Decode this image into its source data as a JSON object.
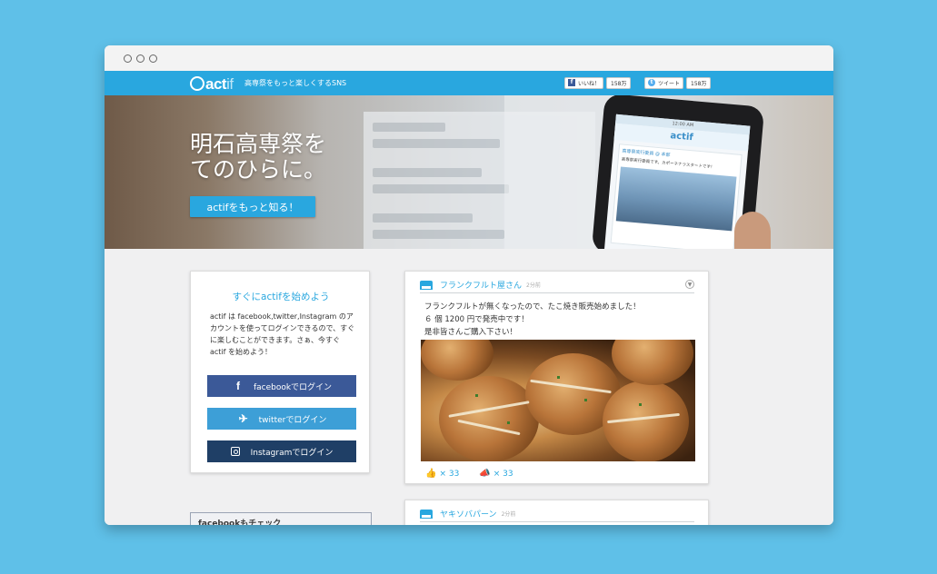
{
  "browser": {
    "controls": [
      "close",
      "minimize",
      "maximize"
    ]
  },
  "header": {
    "logo_main": "act",
    "logo_suffix": "if",
    "tagline": "高専祭をもっと楽しくするSNS",
    "facebook_like": {
      "label": "いいね！",
      "count": "158万"
    },
    "tweet": {
      "label": "ツイート",
      "count": "158万"
    }
  },
  "hero": {
    "headline_line1": "明石高専祭を",
    "headline_line2": "てのひらに。",
    "cta_label": "actifをもっと知る！",
    "phone": {
      "status": "12:00 AM",
      "app_name": "actif",
      "card_title": "高専祭実行委員 @ 本部",
      "card_text": "高専祭実行委員です。カポーネナラスタートです！"
    }
  },
  "login": {
    "title": "すぐにactifを始めよう",
    "description": "actif は facebook,twitter,Instagram のアカウントを使ってログインできるので、すぐに楽しむことができます。さぁ、今すぐ actif を始めよう！",
    "facebook_button": "facebookでログイン",
    "twitter_button": "twitterでログイン",
    "instagram_button": "Instagramでログイン"
  },
  "facebook_box": {
    "title": "facebookもチェック"
  },
  "posts": [
    {
      "shop_name": "フランクフルト屋さん",
      "time": "2分前",
      "text_line1": "フランクフルトが無くなったので、たこ焼き販売始めました！",
      "text_line2": "６ 個 1200 円で発売中です！",
      "text_line3": "是非皆さんご購入下さい！",
      "likes": "× 33",
      "shares": "× 33"
    },
    {
      "shop_name": "ヤキソバパーン",
      "time": "2分前"
    }
  ],
  "colors": {
    "background": "#5fc0e8",
    "accent": "#29a7df",
    "facebook": "#3b5998",
    "twitter": "#3d9fd7",
    "instagram": "#1f3f66"
  }
}
